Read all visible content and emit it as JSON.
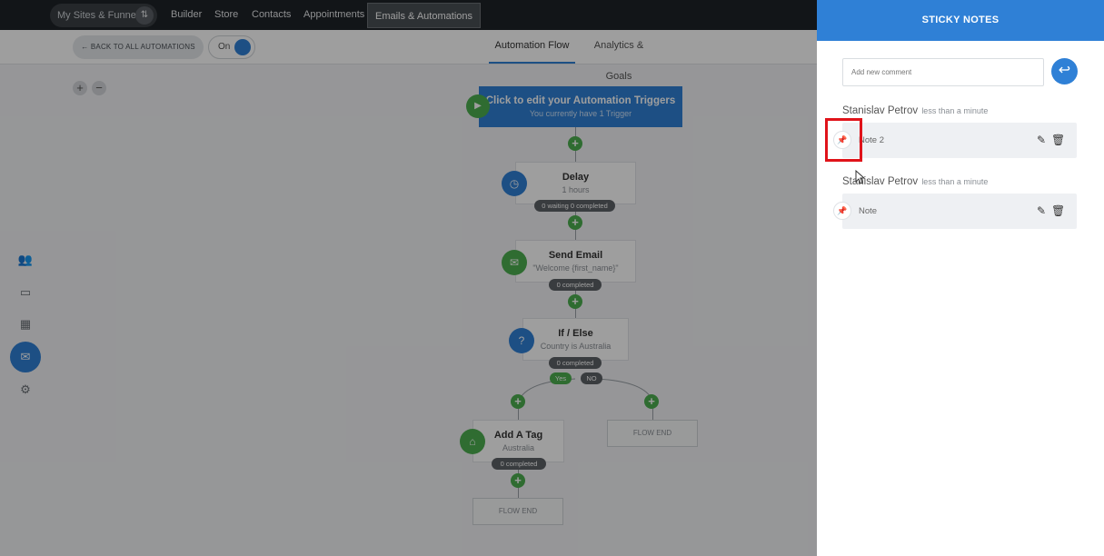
{
  "topnav": {
    "sites_label": "My Sites & Funnels",
    "items": [
      "Builder",
      "Store",
      "Contacts",
      "Appointments",
      "Emails & Automations"
    ]
  },
  "subbar": {
    "back_label": "← BACK TO ALL AUTOMATIONS",
    "toggle_label": "On",
    "tabs": [
      "Automation Flow",
      "Analytics & Goals"
    ]
  },
  "zoom": {
    "plus": "+",
    "minus": "−"
  },
  "flow": {
    "trigger": {
      "title": "Click to edit your Automation Triggers",
      "subtitle": "You currently have 1 Trigger"
    },
    "delay": {
      "title": "Delay",
      "subtitle": "1 hours",
      "stats": "0 waiting  0 completed"
    },
    "send_email": {
      "title": "Send Email",
      "subtitle": "\"Welcome {first_name}\"",
      "stats": "0 completed"
    },
    "if_else": {
      "title": "If / Else",
      "subtitle": "Country is Australia",
      "stats": "0 completed",
      "yes": "Yes",
      "no": "NO"
    },
    "add_tag": {
      "title": "Add A Tag",
      "subtitle": "Australia",
      "stats": "0 completed"
    },
    "flow_end": "FLOW END"
  },
  "panel": {
    "title": "STICKY NOTES",
    "input_placeholder": "Add new comment",
    "notes": [
      {
        "author": "Stanislav Petrov",
        "time": "less than a minute",
        "text": "Note 2"
      },
      {
        "author": "Stanislav Petrov",
        "time": "less than a minute",
        "text": "Note"
      }
    ]
  },
  "colors": {
    "accent": "#2f80d6",
    "success": "#4caf50",
    "highlight": "#e0131a",
    "nav_bg": "#1e2227"
  }
}
